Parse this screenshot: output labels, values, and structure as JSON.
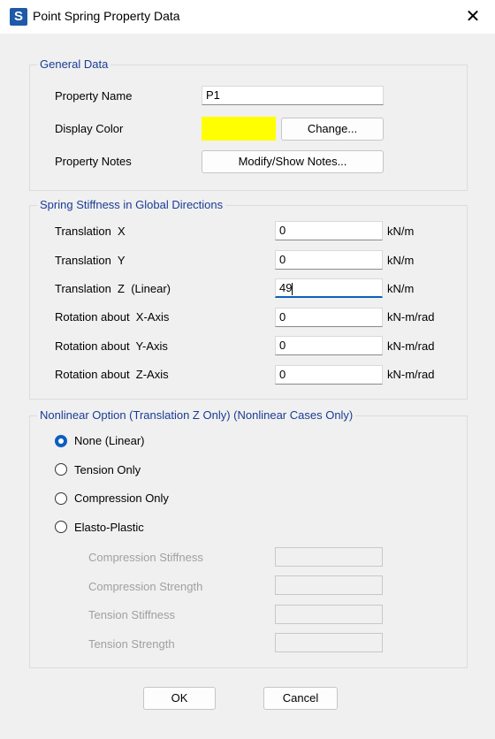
{
  "window": {
    "title": "Point Spring Property Data",
    "app_icon_letter": "S",
    "close_glyph": "✕"
  },
  "general": {
    "legend": "General Data",
    "property_name_label": "Property Name",
    "property_name_value": "P1",
    "display_color_label": "Display Color",
    "display_color": "#ffff00",
    "change_label": "Change...",
    "notes_label": "Property Notes",
    "notes_button": "Modify/Show Notes..."
  },
  "stiffness": {
    "legend": "Spring Stiffness in Global Directions",
    "rows": [
      {
        "label": "Translation  X",
        "value": "0",
        "unit": "kN/m"
      },
      {
        "label": "Translation  Y",
        "value": "0",
        "unit": "kN/m"
      },
      {
        "label": "Translation  Z  (Linear)",
        "value": "49",
        "unit": "kN/m"
      },
      {
        "label": "Rotation about  X-Axis",
        "value": "0",
        "unit": "kN-m/rad"
      },
      {
        "label": "Rotation about  Y-Axis",
        "value": "0",
        "unit": "kN-m/rad"
      },
      {
        "label": "Rotation about  Z-Axis",
        "value": "0",
        "unit": "kN-m/rad"
      }
    ]
  },
  "nonlinear": {
    "legend": "Nonlinear Option  (Translation Z Only)  (Nonlinear Cases Only)",
    "options": [
      {
        "label": "None (Linear)",
        "checked": true
      },
      {
        "label": "Tension Only",
        "checked": false
      },
      {
        "label": "Compression Only",
        "checked": false
      },
      {
        "label": "Elasto-Plastic",
        "checked": false
      }
    ],
    "fields": [
      {
        "label": "Compression Stiffness",
        "value": ""
      },
      {
        "label": "Compression Strength",
        "value": ""
      },
      {
        "label": "Tension Stiffness",
        "value": ""
      },
      {
        "label": "Tension Strength",
        "value": ""
      }
    ]
  },
  "buttons": {
    "ok": "OK",
    "cancel": "Cancel"
  }
}
